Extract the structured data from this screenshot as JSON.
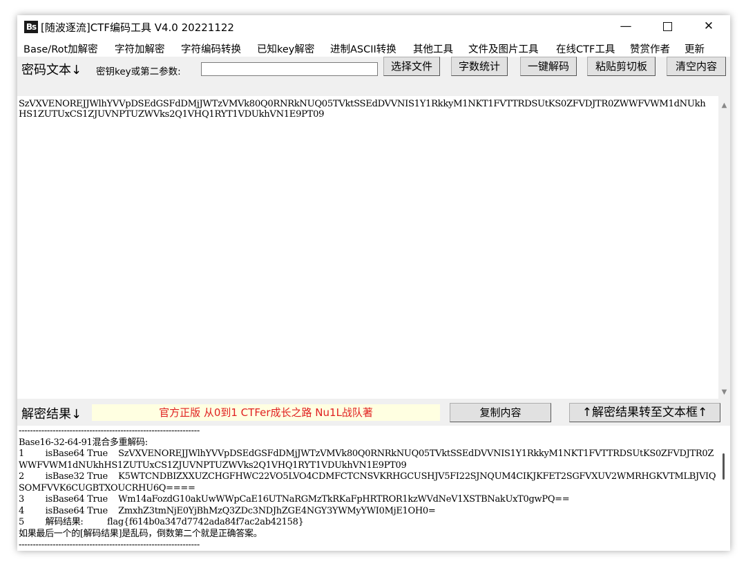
{
  "window": {
    "icon_text": "Bs",
    "title": "[随波逐流]CTF编码工具 V4.0 20221122",
    "min_glyph": "—",
    "close_glyph": "✕"
  },
  "menu": [
    "Base/Rot加解密",
    "字符加解密",
    "字符编码转换",
    "已知key解密",
    "进制ASCII转换",
    "其他工具",
    "文件及图片工具",
    "在线CTF工具",
    "赞赏作者",
    "更新"
  ],
  "toolbar": {
    "cipher_label": "密码文本↓",
    "key_label": "密钥key或第二参数:",
    "key_value": "",
    "buttons": [
      "选择文件",
      "字数统计",
      "一键解码",
      "粘贴剪切板",
      "清空内容"
    ]
  },
  "cipher_text": "SzVXVENOREJJWlhYVVpDSEdGSFdDMjJWTzVMVk80Q0RNRkNUQ05TVktSSEdDVVNIS1Y1RkkyM1NKT1FVTTRDSUtKS0ZFVDJTR0ZWWFVWM1dNUkhHS1ZUTUxCS1ZJUVNPTUZWVks2Q1VHQ1RYT1VDUkhVN1E9PT09",
  "result": {
    "label": "解密结果↓",
    "banner": "官方正版 从0到1 CTFer成长之路 Nu1L战队著",
    "copy_button": "复制内容",
    "transfer_button": "↑解密结果转至文本框↑",
    "output_lines": [
      "----------------------------------------------------------------",
      "Base16-32-64-91混合多重解码:",
      "1        isBase64 True    SzVXVENOREJJWlhYVVpDSEdGSFdDMjJWTzVMVk80Q0RNRkNUQ05TVktSSEdDVVNIS1Y1RkkyM1NKT1FVTTRDSUtKS0ZFVDJTR0ZWWFVWM1dNUkhHS1ZUTUxCS1ZJUVNPTUZWVks2Q1VHQ1RYT1VDUkhVN1E9PT09",
      "2        isBase32 True    K5WTCNDBIZXXUZCHGFHWC22VO5LVO4CDMFCTCNSVKRHGCUSHJV5FI22SJNQUM4CIKJKFET2SGFVXUV2WMRHGKVTMLBJVIQSOMFVVK6CUGBTXOUCRHU6Q====",
      "3        isBase64 True    Wm14aFozdG10akUwWWpCaE16UTNaRGMzTkRKaFpHRTROR1kzWVdNeV1XSTBNakUxT0gwPQ==",
      "4        isBase64 True    ZmxhZ3tmNjE0YjBhMzQ3ZDc3NDJhZGE4NGY3YWMyYWI0MjE1OH0=",
      "5        解码结果:         flag{f614b0a347d7742ada84f7ac2ab42158}",
      "如果最后一个的[解码结果]是乱码，倒数第二个就是正确答案。",
      "----------------------------------------------------------------"
    ]
  }
}
